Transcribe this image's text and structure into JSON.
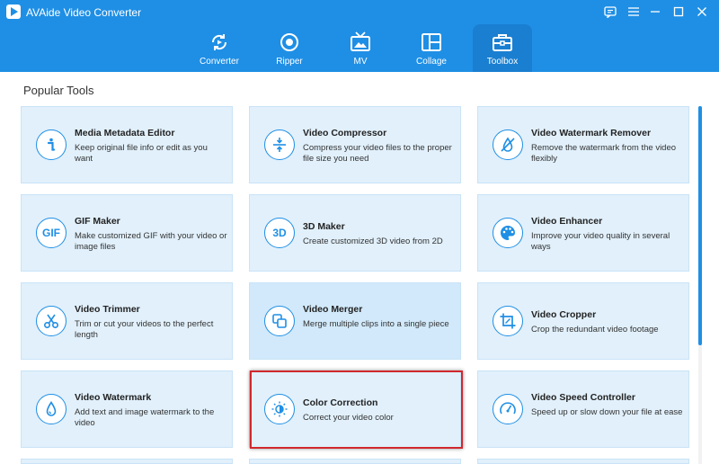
{
  "app": {
    "title": "AVAide Video Converter"
  },
  "nav": {
    "tabs": [
      {
        "label": "Converter",
        "icon": "converter-icon"
      },
      {
        "label": "Ripper",
        "icon": "ripper-icon"
      },
      {
        "label": "MV",
        "icon": "mv-icon"
      },
      {
        "label": "Collage",
        "icon": "collage-icon"
      },
      {
        "label": "Toolbox",
        "icon": "toolbox-icon",
        "active": true
      }
    ]
  },
  "section": {
    "title": "Popular Tools"
  },
  "tools": [
    {
      "name": "Media Metadata Editor",
      "desc": "Keep original file info or edit as you want",
      "icon": "info-icon"
    },
    {
      "name": "Video Compressor",
      "desc": "Compress your video files to the proper file size you need",
      "icon": "compress-icon"
    },
    {
      "name": "Video Watermark Remover",
      "desc": "Remove the watermark from the video flexibly",
      "icon": "watermark-remove-icon"
    },
    {
      "name": "GIF Maker",
      "desc": "Make customized GIF with your video or image files",
      "icon": "gif-icon",
      "icon_text": "GIF"
    },
    {
      "name": "3D Maker",
      "desc": "Create customized 3D video from 2D",
      "icon": "3d-icon",
      "icon_text": "3D"
    },
    {
      "name": "Video Enhancer",
      "desc": "Improve your video quality in several ways",
      "icon": "palette-icon"
    },
    {
      "name": "Video Trimmer",
      "desc": "Trim or cut your videos to the perfect length",
      "icon": "scissors-icon"
    },
    {
      "name": "Video Merger",
      "desc": "Merge multiple clips into a single piece",
      "icon": "merge-icon"
    },
    {
      "name": "Video Cropper",
      "desc": "Crop the redundant video footage",
      "icon": "crop-icon"
    },
    {
      "name": "Video Watermark",
      "desc": "Add text and image watermark to the video",
      "icon": "droplet-icon"
    },
    {
      "name": "Color Correction",
      "desc": "Correct your video color",
      "icon": "color-correction-icon"
    },
    {
      "name": "Video Speed Controller",
      "desc": "Speed up or slow down your file at ease",
      "icon": "speedometer-icon"
    }
  ],
  "colors": {
    "accent": "#1f8fe5",
    "card_bg": "#e1f0fb",
    "highlight": "#d0282e"
  }
}
